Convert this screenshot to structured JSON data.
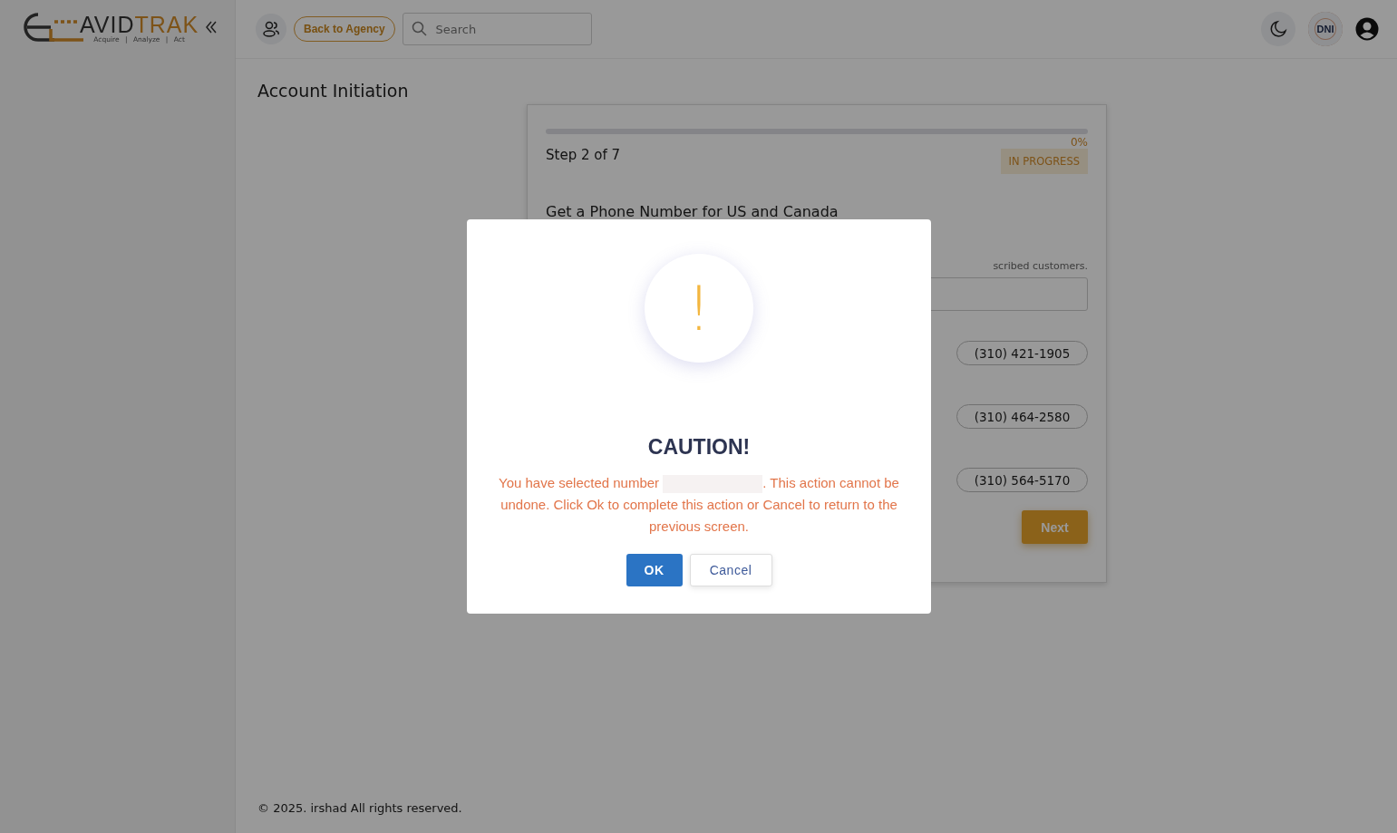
{
  "logo": {
    "word_dark": "AVID",
    "word_accent": "TRAK",
    "tagline": "Acquire | Analyze | Act"
  },
  "header": {
    "back_button": "Back to Agency",
    "search": {
      "placeholder": "Search"
    },
    "badge": "DNI"
  },
  "page_title": "Account Initiation",
  "wizard": {
    "progress": {
      "level": 0,
      "reading": "0%"
    },
    "step": "Step 2 of 7",
    "status": "IN PROGRESS",
    "heading": "Get a Phone Number for US and Canada",
    "note": "scribed customers.",
    "numbers": [
      {
        "number": "(310) 421-1905",
        "selected": false
      },
      {
        "number": "(310) 464-2580",
        "selected": false
      },
      {
        "number": "(310) 564-5170",
        "selected": false
      }
    ],
    "next_button": "Next"
  },
  "footer": "© 2025. irshad All rights reserved.",
  "dialog": {
    "title": "CAUTION!",
    "icon_glyph": "!",
    "message_start": "You have selected number",
    "message_end": ". This action cannot be undone. Click Ok to complete this action or Cancel to return to the previous screen.",
    "buttons": [
      {
        "label": "OK",
        "kind": "primary"
      },
      {
        "label": "Cancel",
        "kind": "secondary"
      }
    ]
  }
}
